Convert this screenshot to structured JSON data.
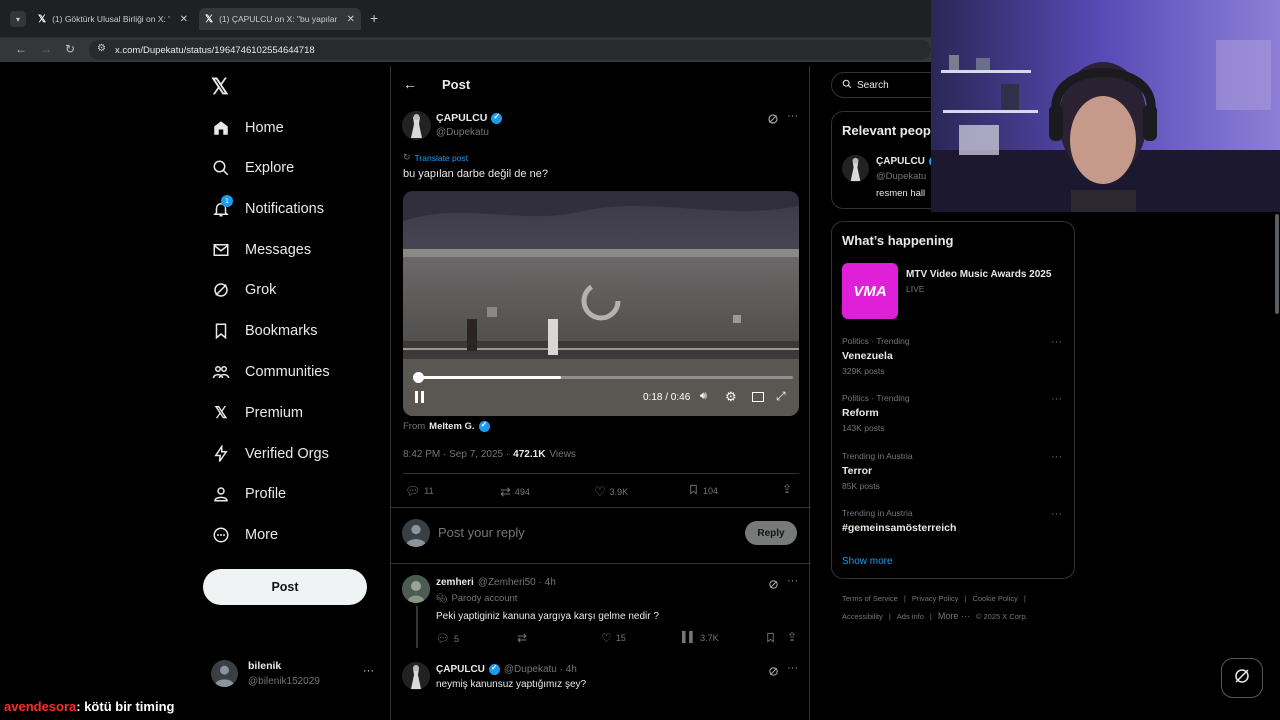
{
  "browser": {
    "tabs": [
      {
        "title": "(1) Göktürk Ulusal Birliği on X: \"...",
        "active": false
      },
      {
        "title": "(1) ÇAPULCU on X: \"bu yapılan d...",
        "active": true
      }
    ],
    "url": "x.com/Dupekatu/status/1964746102554644718"
  },
  "nav": {
    "items": [
      {
        "label": "Home",
        "icon": "home-icon"
      },
      {
        "label": "Explore",
        "icon": "search-icon"
      },
      {
        "label": "Notifications",
        "icon": "bell-icon",
        "badge": "1"
      },
      {
        "label": "Messages",
        "icon": "mail-icon"
      },
      {
        "label": "Grok",
        "icon": "grok-icon"
      },
      {
        "label": "Bookmarks",
        "icon": "bookmark-icon"
      },
      {
        "label": "Communities",
        "icon": "communities-icon"
      },
      {
        "label": "Premium",
        "icon": "x-icon"
      },
      {
        "label": "Verified Orgs",
        "icon": "lightning-icon"
      },
      {
        "label": "Profile",
        "icon": "person-icon"
      },
      {
        "label": "More",
        "icon": "more-circle-icon"
      }
    ],
    "post_label": "Post",
    "account": {
      "name": "bilenik",
      "handle": "@bilenik152029"
    }
  },
  "header": {
    "title": "Post"
  },
  "post": {
    "author": "ÇAPULCU",
    "handle": "@Dupekatu",
    "translate": "Translate post",
    "text": "bu yapılan darbe değil de ne?",
    "video": {
      "time": "0:18 / 0:46",
      "progress": 0.39
    },
    "from_label": "From",
    "from_name": "Meltem G.",
    "timestamp": "8:42 PM · Sep 7, 2025 ·",
    "views_count": "472.1K",
    "views_label": "Views",
    "stats": {
      "replies": "11",
      "reposts": "494",
      "likes": "3.9K",
      "bookmarks": "104"
    }
  },
  "reply_box": {
    "placeholder": "Post your reply",
    "button": "Reply"
  },
  "replies": [
    {
      "name": "zemheri",
      "handle": "@Zemheri50 · 4h",
      "badge": "Parody account",
      "text": "Peki yaptiginiz kanuna yargıya karşı gelme nedir ?",
      "replies": "5",
      "likes": "15",
      "views": "3.7K"
    },
    {
      "name": "ÇAPULCU",
      "handle": "@Dupekatu · 4h",
      "text": "neymiş kanunsuz yaptığımız şey?"
    }
  ],
  "search": {
    "placeholder": "Search"
  },
  "relevant": {
    "title": "Relevant people",
    "name": "ÇAPULCU",
    "handle": "@Dupekatu",
    "bio": "resmen hall"
  },
  "happening": {
    "title": "What’s happening",
    "event": {
      "title": "MTV Video Music Awards 2025",
      "status": "LIVE"
    },
    "trends": [
      {
        "meta": "Politics · Trending",
        "title": "Venezuela",
        "posts": "329K posts"
      },
      {
        "meta": "Politics · Trending",
        "title": "Reform",
        "posts": "143K posts"
      },
      {
        "meta": "Trending in Austria",
        "title": "Terror",
        "posts": "85K posts"
      },
      {
        "meta": "Trending in Austria",
        "title": "#gemeinsamösterreich",
        "posts": ""
      }
    ],
    "show_more": "Show more"
  },
  "footer": {
    "links1": [
      "Terms of Service",
      "Privacy Policy",
      "Cookie Policy"
    ],
    "links2": [
      "Accessibility",
      "Ads info",
      "More ···",
      "© 2025 X Corp."
    ]
  },
  "chat_overlay": {
    "user": "avendesora",
    "message": ": kötü bir timing"
  },
  "colors": {
    "accent": "#1d9bf0",
    "chat_user": "#ff2a2a"
  }
}
